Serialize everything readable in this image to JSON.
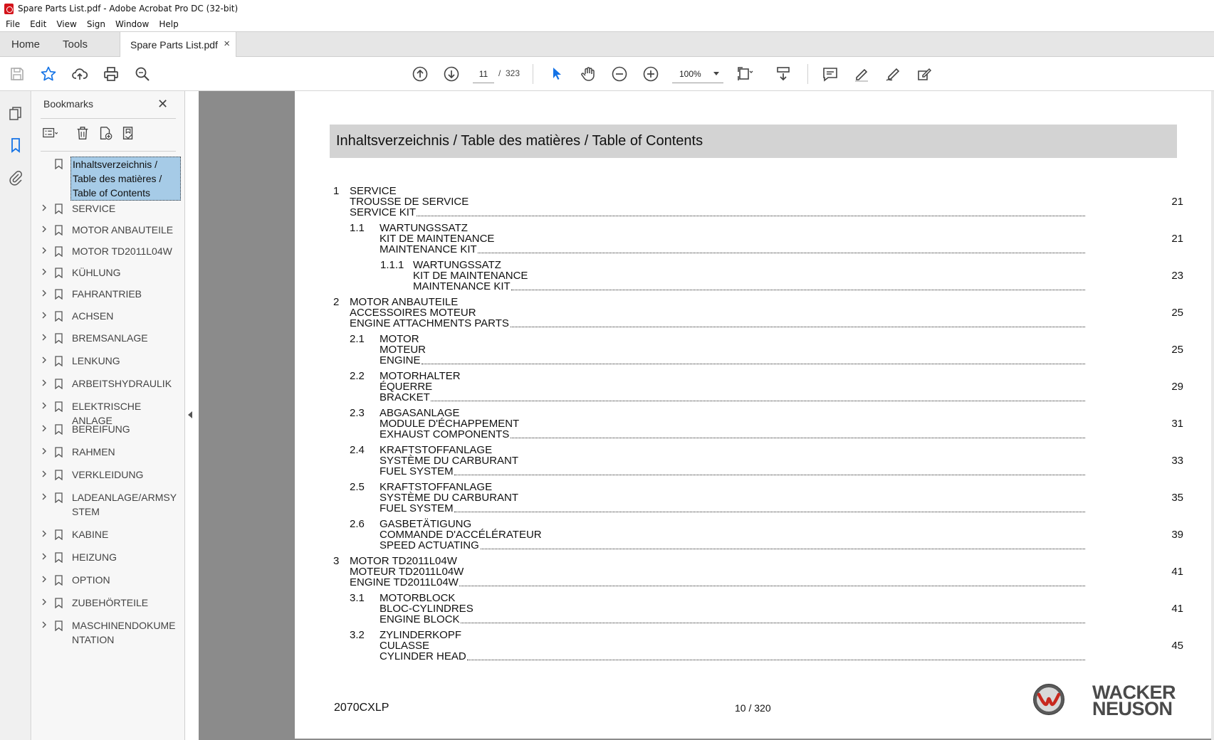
{
  "window": {
    "title": "Spare Parts List.pdf - Adobe Acrobat Pro DC (32-bit)"
  },
  "menu": [
    "File",
    "Edit",
    "View",
    "Sign",
    "Window",
    "Help"
  ],
  "tabs": {
    "home": "Home",
    "tools": "Tools",
    "document": "Spare Parts List.pdf",
    "close": "×"
  },
  "toolbar": {
    "page_current": "11",
    "page_sep": "/",
    "page_total": "323",
    "zoom": "100%"
  },
  "bookmarks": {
    "title": "Bookmarks",
    "close": "✕",
    "items": [
      {
        "label": "Inhaltsverzeichnis / Table des matières / Table of Contents",
        "selected": true
      },
      {
        "label": "SERVICE"
      },
      {
        "label": "MOTOR ANBAUTEILE"
      },
      {
        "label": "MOTOR TD2011L04W"
      },
      {
        "label": "KÜHLUNG"
      },
      {
        "label": "FAHRANTRIEB"
      },
      {
        "label": "ACHSEN"
      },
      {
        "label": "BREMSANLAGE"
      },
      {
        "label": "LENKUNG"
      },
      {
        "label": "ARBEITSHYDRAULIK"
      },
      {
        "label": "ELEKTRISCHE ANLAGE"
      },
      {
        "label": "BEREIFUNG"
      },
      {
        "label": "RAHMEN"
      },
      {
        "label": "VERKLEIDUNG"
      },
      {
        "label": "LADEANLAGE/ARMSYSTEM"
      },
      {
        "label": "KABINE"
      },
      {
        "label": "HEIZUNG"
      },
      {
        "label": "OPTION"
      },
      {
        "label": "ZUBEHÖRTEILE"
      },
      {
        "label": "MASCHINENDOKUMENTATION"
      }
    ]
  },
  "document": {
    "heading": "Inhaltsverzeichnis / Table des matières / Table of Contents",
    "entries": [
      {
        "num": "1",
        "level": 0,
        "lines": [
          "SERVICE",
          "TROUSSE DE SERVICE",
          "SERVICE KIT"
        ],
        "page": "21"
      },
      {
        "num": "1.1",
        "level": 1,
        "lines": [
          "WARTUNGSSATZ",
          "KIT DE MAINTENANCE",
          "MAINTENANCE KIT"
        ],
        "page": "21"
      },
      {
        "num": "1.1.1",
        "level": 2,
        "lines": [
          "WARTUNGSSATZ",
          "KIT DE MAINTENANCE",
          "MAINTENANCE KIT"
        ],
        "page": "23"
      },
      {
        "num": "2",
        "level": 0,
        "lines": [
          "MOTOR ANBAUTEILE",
          "ACCESSOIRES MOTEUR",
          "ENGINE ATTACHMENTS PARTS"
        ],
        "page": "25"
      },
      {
        "num": "2.1",
        "level": 1,
        "lines": [
          "MOTOR",
          "MOTEUR",
          "ENGINE"
        ],
        "page": "25"
      },
      {
        "num": "2.2",
        "level": 1,
        "lines": [
          "MOTORHALTER",
          "ÉQUERRE",
          "BRACKET"
        ],
        "page": "29"
      },
      {
        "num": "2.3",
        "level": 1,
        "lines": [
          "ABGASANLAGE",
          "MODULE D'ÉCHAPPEMENT",
          "EXHAUST COMPONENTS"
        ],
        "page": "31"
      },
      {
        "num": "2.4",
        "level": 1,
        "lines": [
          "KRAFTSTOFFANLAGE",
          "SYSTÈME DU CARBURANT",
          "FUEL SYSTEM"
        ],
        "page": "33"
      },
      {
        "num": "2.5",
        "level": 1,
        "lines": [
          "KRAFTSTOFFANLAGE",
          "SYSTÈME DU CARBURANT",
          "FUEL SYSTEM"
        ],
        "page": "35"
      },
      {
        "num": "2.6",
        "level": 1,
        "lines": [
          "GASBETÄTIGUNG",
          "COMMANDE D'ACCÉLÉRATEUR",
          "SPEED ACTUATING"
        ],
        "page": "39"
      },
      {
        "num": "3",
        "level": 0,
        "lines": [
          "MOTOR TD2011L04W",
          "MOTEUR TD2011L04W",
          "ENGINE TD2011L04W"
        ],
        "page": "41"
      },
      {
        "num": "3.1",
        "level": 1,
        "lines": [
          "MOTORBLOCK",
          "BLOC-CYLINDRES",
          "ENGINE BLOCK"
        ],
        "page": "41"
      },
      {
        "num": "3.2",
        "level": 1,
        "lines": [
          "ZYLINDERKOPF",
          "CULASSE",
          "CYLINDER HEAD"
        ],
        "page": "45"
      }
    ],
    "footer_model": "2070CXLP",
    "footer_page": "10 / 320",
    "brand": [
      "WACKER",
      "NEUSON"
    ]
  }
}
